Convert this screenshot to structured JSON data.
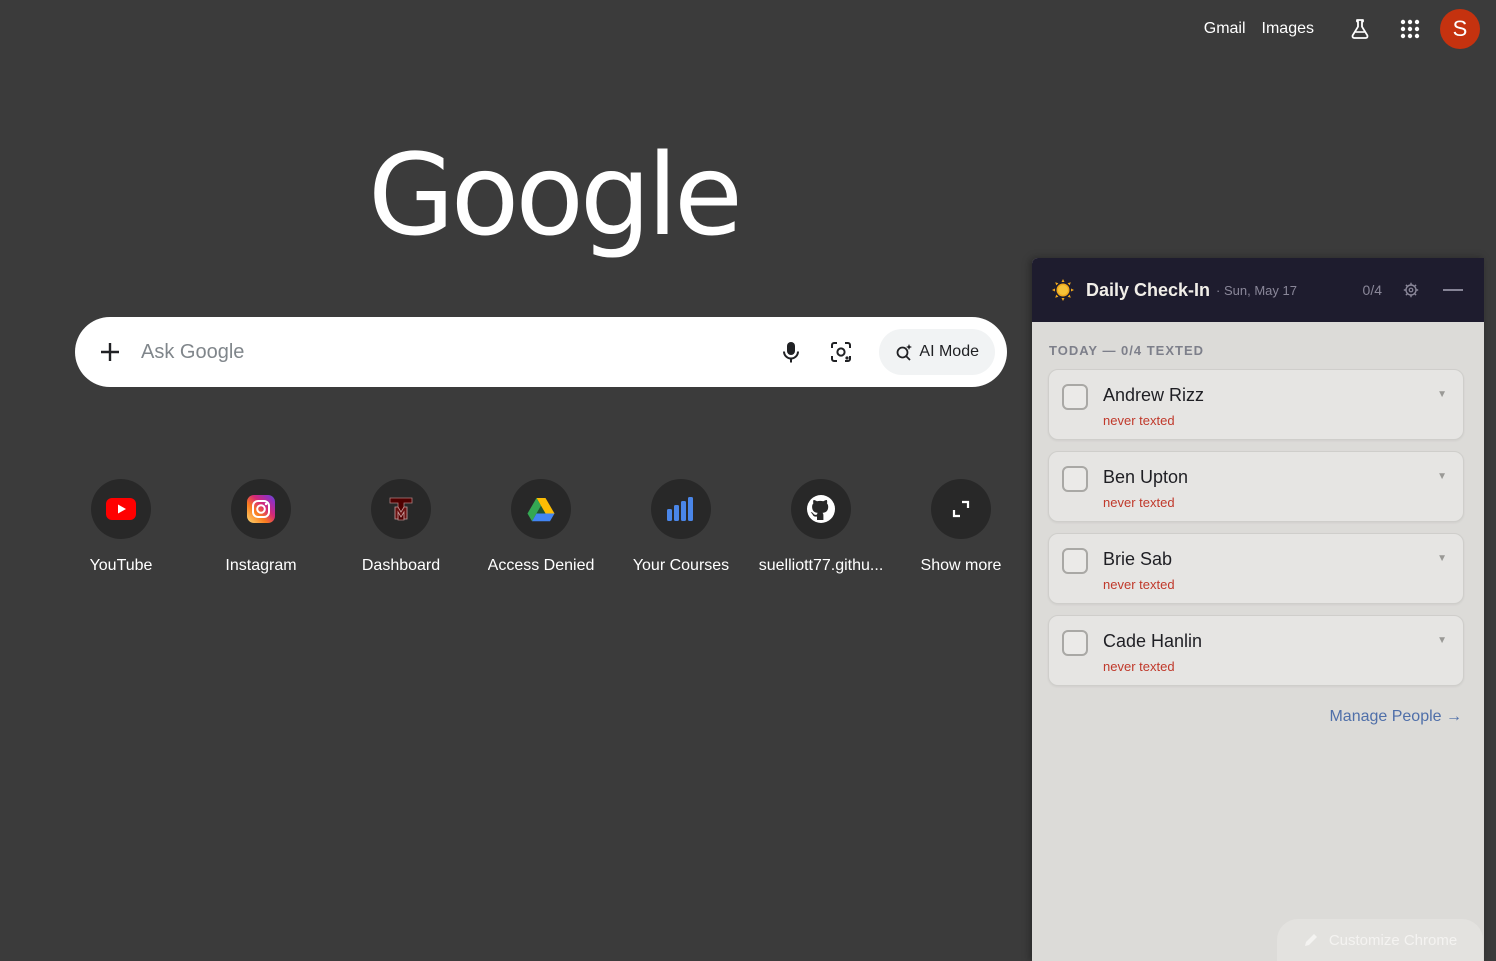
{
  "topbar": {
    "gmail": "Gmail",
    "images": "Images",
    "avatar_letter": "S"
  },
  "logo": {
    "text": "Google"
  },
  "search": {
    "placeholder": "Ask Google",
    "ai_mode_label": "AI Mode"
  },
  "shortcuts": [
    {
      "label": "YouTube",
      "icon": "youtube-icon"
    },
    {
      "label": "Instagram",
      "icon": "instagram-icon"
    },
    {
      "label": "Dashboard",
      "icon": "tamu-icon"
    },
    {
      "label": "Access Denied",
      "icon": "google-drive-icon"
    },
    {
      "label": "Your Courses",
      "icon": "bar-chart-icon"
    },
    {
      "label": "suelliott77.githu...",
      "icon": "github-icon"
    },
    {
      "label": "Show more",
      "icon": "expand-icon"
    }
  ],
  "panel": {
    "title": "Daily Check-In",
    "date": "· Sun, May 17",
    "count": "0/4",
    "section_label": "TODAY — 0/4 TEXTED",
    "people": [
      {
        "name": "Andrew Rizz",
        "status": "never texted"
      },
      {
        "name": "Ben Upton",
        "status": "never texted"
      },
      {
        "name": "Brie Sab",
        "status": "never texted"
      },
      {
        "name": "Cade Hanlin",
        "status": "never texted"
      }
    ],
    "manage_link": "Manage People →"
  },
  "customize": {
    "label": "Customize Chrome"
  },
  "colors": {
    "background": "#3b3b3b",
    "panel_header": "#1e1c2e",
    "panel_body": "#dcdbd8",
    "status_red": "#c0392b",
    "link_blue": "#4f6fa9",
    "avatar": "#c5320f"
  }
}
